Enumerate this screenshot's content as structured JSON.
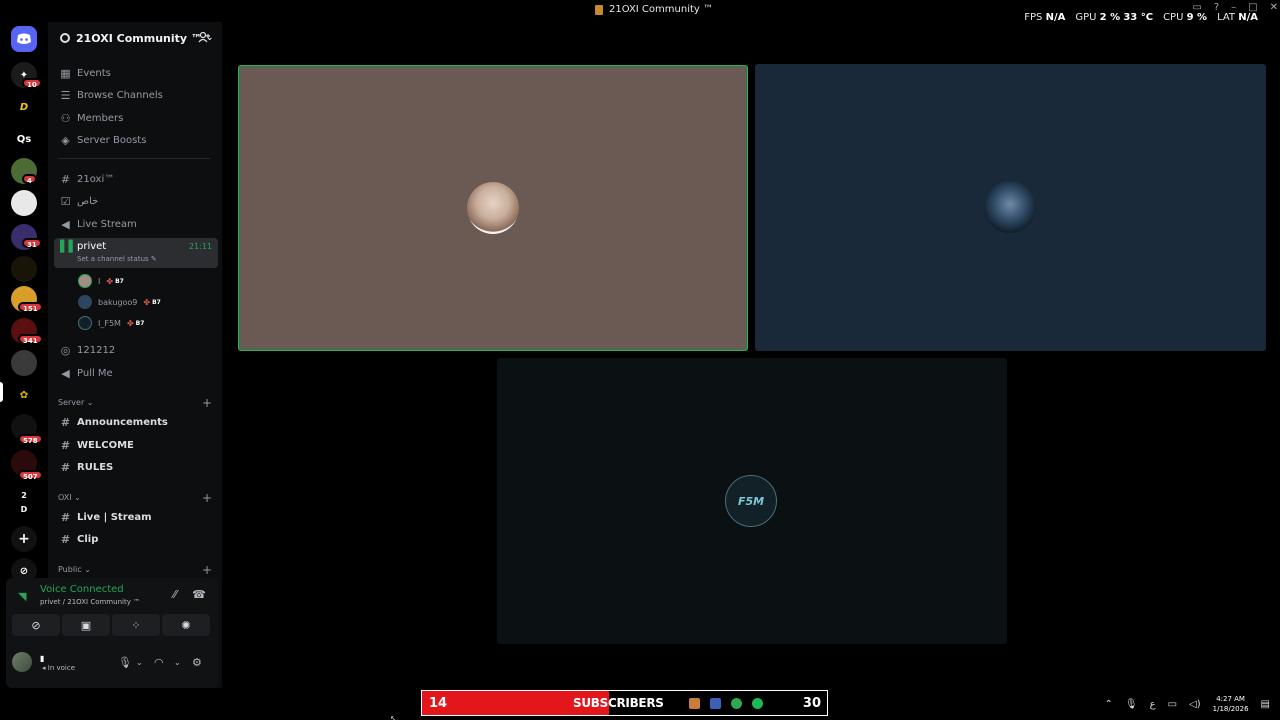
{
  "window": {
    "title": "21OXI Community ™",
    "overlay": {
      "fps_label": "FPS",
      "fps_value": "N/A",
      "gpu_label": "GPU",
      "gpu_value": "2 %",
      "gpu_temp": "33 °C",
      "cpu_label": "CPU",
      "cpu_value": "9 %",
      "lat_label": "LAT",
      "lat_value": "N/A"
    }
  },
  "servers": [
    {
      "name": "home",
      "badge": ""
    },
    {
      "name": "server-1",
      "badge": "10"
    },
    {
      "name": "server-2",
      "badge": ""
    },
    {
      "name": "server-qs",
      "label": "Qs",
      "badge": ""
    },
    {
      "name": "server-4",
      "badge": "4"
    },
    {
      "name": "server-5",
      "badge": ""
    },
    {
      "name": "server-6",
      "badge": "31"
    },
    {
      "name": "server-7",
      "badge": ""
    },
    {
      "name": "server-8",
      "badge": "151"
    },
    {
      "name": "server-9",
      "badge": "341"
    },
    {
      "name": "server-10",
      "badge": ""
    },
    {
      "name": "server-11",
      "badge": ""
    },
    {
      "name": "server-12",
      "badge": "578"
    },
    {
      "name": "server-13",
      "badge": "507"
    },
    {
      "name": "server-14",
      "badge": ""
    }
  ],
  "folder_labels": {
    "top": "2",
    "bottom": "D"
  },
  "guild": {
    "name": "21OXI Community ™"
  },
  "nav": {
    "events": "Events",
    "browse": "Browse Channels",
    "members": "Members",
    "boosts": "Server Boosts"
  },
  "channels": {
    "c1": "21oxi™",
    "c2": "خاص",
    "c3": "Live Stream",
    "c4": "privet",
    "c4_time": "21:11",
    "c4_status": "Set a channel status",
    "c5": "121212",
    "c6": "Pull Me"
  },
  "voice_users": [
    {
      "name": "I",
      "tag": "B7"
    },
    {
      "name": "bakugoo9",
      "tag": "B7"
    },
    {
      "name": "I_F5M",
      "tag": "B7"
    }
  ],
  "categories": {
    "server": "Server",
    "server_channels": [
      "Announcements",
      "WELCOME",
      "RULES"
    ],
    "oxi": "OXI",
    "oxi_channels": [
      "Live | Stream",
      "Clip"
    ],
    "public": "Public"
  },
  "voice_panel": {
    "title": "Voice Connected",
    "subtitle": "privet / 21OXI Community ™",
    "status": "In voice"
  },
  "tiles": {
    "third_logo": "F5M"
  },
  "widget": {
    "left_value": "14",
    "label": "SUBSCRIBERS",
    "right_value": "30"
  },
  "tray": {
    "lang": "ع",
    "time": "4:27 AM",
    "date": "1/18/2026"
  }
}
